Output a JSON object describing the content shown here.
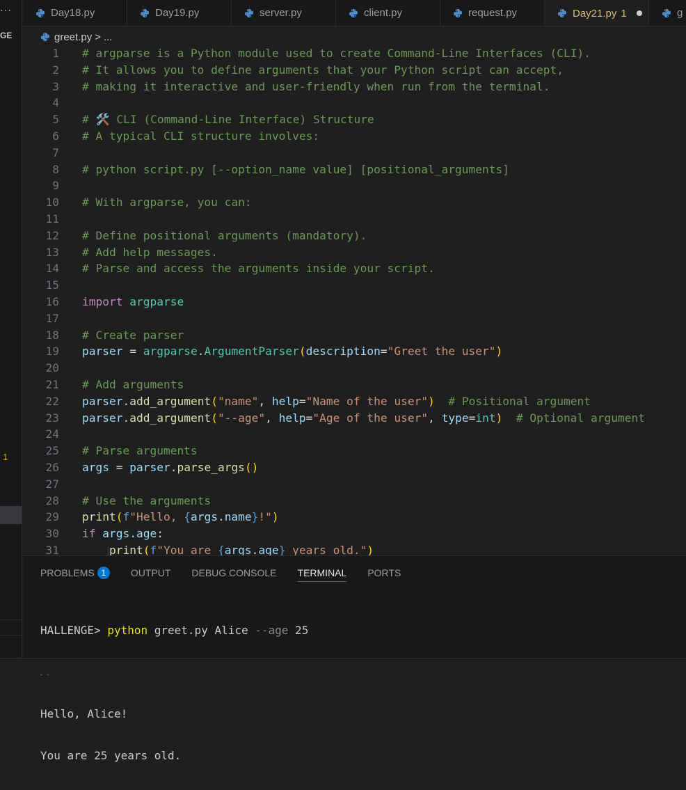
{
  "sidebar": {
    "more": "···",
    "section_label": "GE",
    "problem_count": "1"
  },
  "tabs": [
    {
      "label": "Day18.py",
      "active": false
    },
    {
      "label": "Day19.py",
      "active": false
    },
    {
      "label": "server.py",
      "active": false
    },
    {
      "label": "client.py",
      "active": false
    },
    {
      "label": "request.py",
      "active": false
    },
    {
      "label": "Day21.py",
      "active": true,
      "problems": "1",
      "modified": true
    },
    {
      "label": "g",
      "active": false
    }
  ],
  "breadcrumb": {
    "file": "greet.py",
    "separator": ">",
    "ellipsis": "..."
  },
  "editor": {
    "lines": [
      {
        "n": "1",
        "t": [
          [
            "c",
            "# argparse is a Python module used to create Command-Line Interfaces (CLI)."
          ]
        ]
      },
      {
        "n": "2",
        "t": [
          [
            "c",
            "# It allows you to define arguments that your Python script can accept,"
          ]
        ]
      },
      {
        "n": "3",
        "t": [
          [
            "c",
            "# making it interactive and user-friendly when run from the terminal."
          ]
        ]
      },
      {
        "n": "4",
        "t": []
      },
      {
        "n": "5",
        "t": [
          [
            "c",
            "# 🛠️ CLI (Command-Line Interface) Structure"
          ]
        ]
      },
      {
        "n": "6",
        "t": [
          [
            "c",
            "# A typical CLI structure involves:"
          ]
        ]
      },
      {
        "n": "7",
        "t": []
      },
      {
        "n": "8",
        "t": [
          [
            "c",
            "# python script.py [--option_name value] [positional_arguments]"
          ]
        ]
      },
      {
        "n": "9",
        "t": []
      },
      {
        "n": "10",
        "t": [
          [
            "c",
            "# With argparse, you can:"
          ]
        ]
      },
      {
        "n": "11",
        "t": []
      },
      {
        "n": "12",
        "t": [
          [
            "c",
            "# Define positional arguments (mandatory)."
          ]
        ]
      },
      {
        "n": "13",
        "t": [
          [
            "c",
            "# Add help messages."
          ]
        ]
      },
      {
        "n": "14",
        "t": [
          [
            "c",
            "# Parse and access the arguments inside your script."
          ]
        ]
      },
      {
        "n": "15",
        "t": []
      },
      {
        "n": "16",
        "t": [
          [
            "k",
            "import"
          ],
          [
            "p",
            " "
          ],
          [
            "t",
            "argparse"
          ]
        ]
      },
      {
        "n": "17",
        "t": []
      },
      {
        "n": "18",
        "t": [
          [
            "c",
            "# Create parser"
          ]
        ]
      },
      {
        "n": "19",
        "t": [
          [
            "v",
            "parser"
          ],
          [
            "p",
            " = "
          ],
          [
            "t",
            "argparse"
          ],
          [
            "p",
            "."
          ],
          [
            "t",
            "ArgumentParser"
          ],
          [
            "b",
            "("
          ],
          [
            "v",
            "description"
          ],
          [
            "p",
            "="
          ],
          [
            "s",
            "\"Greet the user\""
          ],
          [
            "b",
            ")"
          ]
        ]
      },
      {
        "n": "20",
        "t": []
      },
      {
        "n": "21",
        "t": [
          [
            "c",
            "# Add arguments"
          ]
        ]
      },
      {
        "n": "22",
        "t": [
          [
            "v",
            "parser"
          ],
          [
            "p",
            "."
          ],
          [
            "f",
            "add_argument"
          ],
          [
            "b",
            "("
          ],
          [
            "s",
            "\"name\""
          ],
          [
            "p",
            ", "
          ],
          [
            "v",
            "help"
          ],
          [
            "p",
            "="
          ],
          [
            "s",
            "\"Name of the user\""
          ],
          [
            "b",
            ")"
          ],
          [
            "p",
            "  "
          ],
          [
            "c",
            "# Positional argument"
          ]
        ]
      },
      {
        "n": "23",
        "t": [
          [
            "v",
            "parser"
          ],
          [
            "p",
            "."
          ],
          [
            "f",
            "add_argument"
          ],
          [
            "b",
            "("
          ],
          [
            "s",
            "\"--age\""
          ],
          [
            "p",
            ", "
          ],
          [
            "v",
            "help"
          ],
          [
            "p",
            "="
          ],
          [
            "s",
            "\"Age of the user\""
          ],
          [
            "p",
            ", "
          ],
          [
            "v",
            "type"
          ],
          [
            "p",
            "="
          ],
          [
            "t",
            "int"
          ],
          [
            "b",
            ")"
          ],
          [
            "p",
            "  "
          ],
          [
            "c",
            "# Optional argument"
          ]
        ]
      },
      {
        "n": "24",
        "t": []
      },
      {
        "n": "25",
        "t": [
          [
            "c",
            "# Parse arguments"
          ]
        ]
      },
      {
        "n": "26",
        "t": [
          [
            "v",
            "args"
          ],
          [
            "p",
            " = "
          ],
          [
            "v",
            "parser"
          ],
          [
            "p",
            "."
          ],
          [
            "f",
            "parse_args"
          ],
          [
            "b",
            "()"
          ]
        ]
      },
      {
        "n": "27",
        "t": []
      },
      {
        "n": "28",
        "t": [
          [
            "c",
            "# Use the arguments"
          ]
        ]
      },
      {
        "n": "29",
        "t": [
          [
            "f",
            "print"
          ],
          [
            "b",
            "("
          ],
          [
            "bl",
            "f"
          ],
          [
            "s",
            "\"Hello, "
          ],
          [
            "bl",
            "{"
          ],
          [
            "v",
            "args"
          ],
          [
            "p",
            "."
          ],
          [
            "v",
            "name"
          ],
          [
            "bl",
            "}"
          ],
          [
            "s",
            "!\""
          ],
          [
            "b",
            ")"
          ]
        ]
      },
      {
        "n": "30",
        "t": [
          [
            "k",
            "if"
          ],
          [
            "p",
            " "
          ],
          [
            "v",
            "args"
          ],
          [
            "p",
            "."
          ],
          [
            "v",
            "age"
          ],
          [
            "p",
            ":"
          ]
        ]
      },
      {
        "n": "31",
        "t": [
          [
            "p",
            "    "
          ],
          [
            "f",
            "print"
          ],
          [
            "b",
            "("
          ],
          [
            "bl",
            "f"
          ],
          [
            "s",
            "\"You are "
          ],
          [
            "bl",
            "{"
          ],
          [
            "v",
            "args"
          ],
          [
            "p",
            "."
          ],
          [
            "v",
            "age"
          ],
          [
            "bl",
            "}"
          ],
          [
            "s",
            " years old.\""
          ],
          [
            "b",
            ")"
          ]
        ]
      }
    ]
  },
  "panel": {
    "tabs": [
      {
        "label": "PROBLEMS",
        "badge": "1",
        "active": false
      },
      {
        "label": "OUTPUT",
        "active": false
      },
      {
        "label": "DEBUG CONSOLE",
        "active": false
      },
      {
        "label": "TERMINAL",
        "active": true
      },
      {
        "label": "PORTS",
        "active": false
      }
    ],
    "terminal": {
      "prompt": "HALLENGE> ",
      "cmd": "python",
      "arg1": " greet.py Alice ",
      "flag": "--age",
      "arg2": " 25",
      "line2": ">>",
      "line3": "Hello, Alice!",
      "line4": "You are 25 years old."
    }
  },
  "colors": {
    "python_icon": "#4d8fd6",
    "accent": "#0078d4",
    "modified": "#d7ba7d"
  }
}
